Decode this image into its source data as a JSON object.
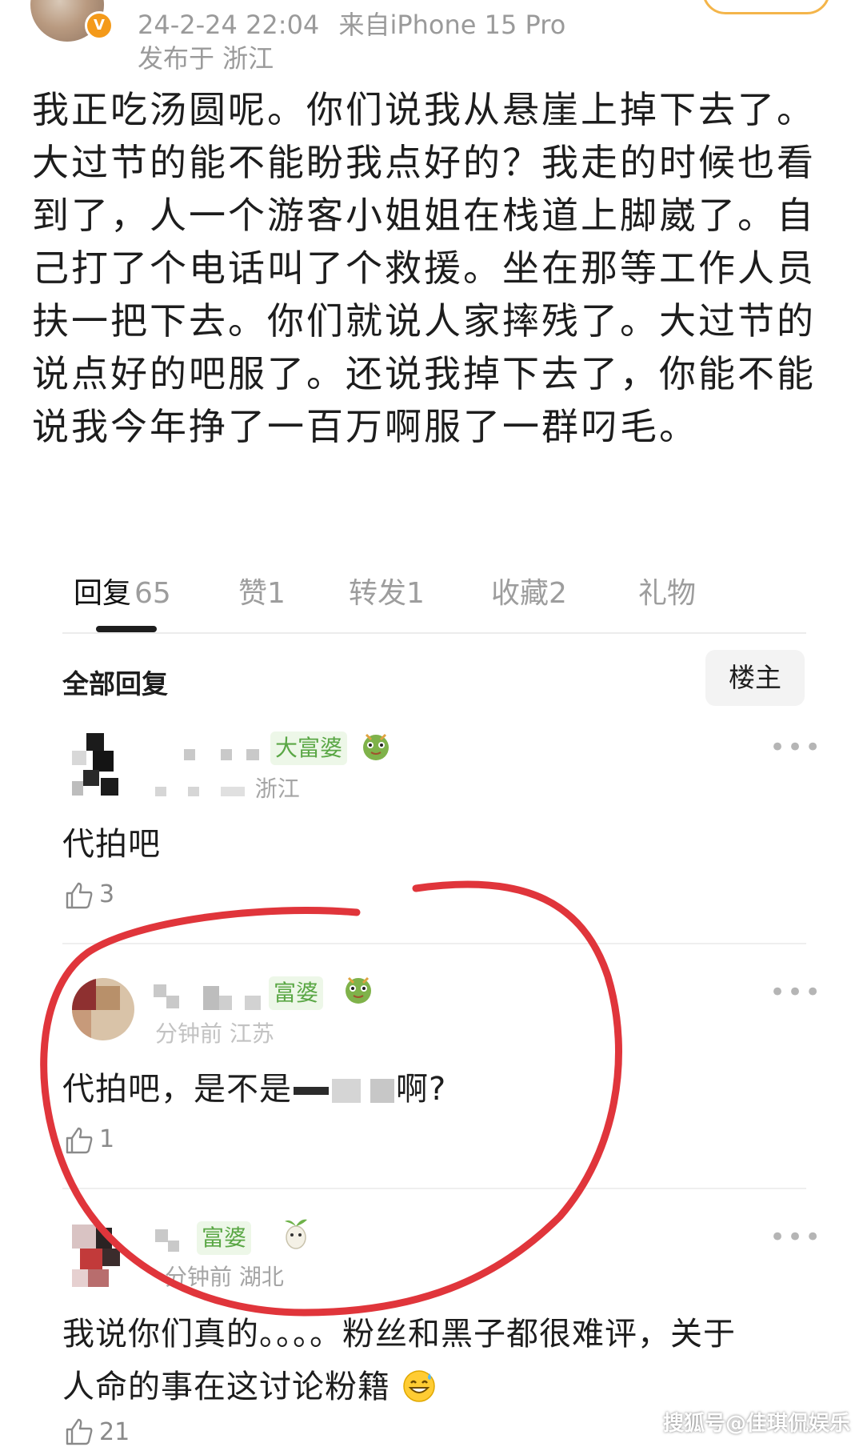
{
  "post": {
    "datetime": "24-2-24 22:04",
    "source": "来自iPhone 15 Pro",
    "location": "发布于 浙江",
    "verified_badge": "V",
    "lines": [
      "我正吃汤圆呢。你们说我从悬崖上掉下去了。",
      "大过节的能不能盼我点好的？我走的时候也看",
      "到了，人一个游客小姐姐在栈道上脚崴了。自",
      "己打了个电话叫了个救援。坐在那等工作人员",
      "扶一把下去。你们就说人家摔残了。大过节的",
      "说点好的吧服了。还说我掉下去了，你能不能",
      "说我今年挣了一百万啊服了一群叼毛。"
    ]
  },
  "tabs": [
    {
      "label": "回复",
      "count": "65"
    },
    {
      "label": "赞",
      "count": "1"
    },
    {
      "label": "转发",
      "count": "1"
    },
    {
      "label": "收藏",
      "count": "2"
    },
    {
      "label": "礼物",
      "count": ""
    }
  ],
  "replies_section": {
    "title": "全部回复",
    "filter_label": "楼主"
  },
  "comments": [
    {
      "badge": "大富婆",
      "meta": "浙江",
      "text": "代拍吧",
      "likes": "3"
    },
    {
      "badge": "富婆",
      "meta": "分钟前 江苏",
      "text_start": "代拍吧，是不是",
      "text_end": "啊?",
      "likes": "1"
    },
    {
      "badge": "富婆",
      "meta": "分钟前 湖北",
      "text_line1": "我说你们真的。。。。粉丝和黑子都很难评，关于",
      "text_line2": "人命的事在这讨论粉籍",
      "likes": "21"
    }
  ],
  "more_label": "•••",
  "watermark": "搜狐号@佳琪侃娱乐",
  "colors": {
    "annotation_circle": "#e0353b",
    "badge_green": "#5aa745",
    "verified_orange": "#f49a1a"
  }
}
